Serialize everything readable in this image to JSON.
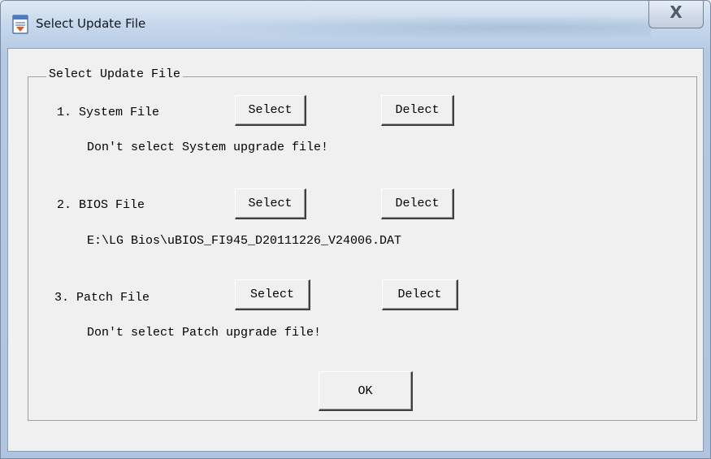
{
  "window": {
    "title": "Select Update File",
    "close_label": "X"
  },
  "group": {
    "label": "Select Update File"
  },
  "rows": [
    {
      "label": "1. System File",
      "select_label": "Select",
      "delect_label": "Delect",
      "status": "Don't select System upgrade file!"
    },
    {
      "label": "2. BIOS File",
      "select_label": "Select",
      "delect_label": "Delect",
      "status": "E:\\LG Bios\\uBIOS_FI945_D20111226_V24006.DAT"
    },
    {
      "label": "3. Patch File",
      "select_label": "Select",
      "delect_label": "Delect",
      "status": "Don't select Patch upgrade file!"
    }
  ],
  "ok_label": "OK",
  "icons": {
    "app": "document-icon",
    "close": "close-icon"
  },
  "colors": {
    "titlebar": "#c9d9ec",
    "dialog_bg": "#f0f0f0"
  }
}
